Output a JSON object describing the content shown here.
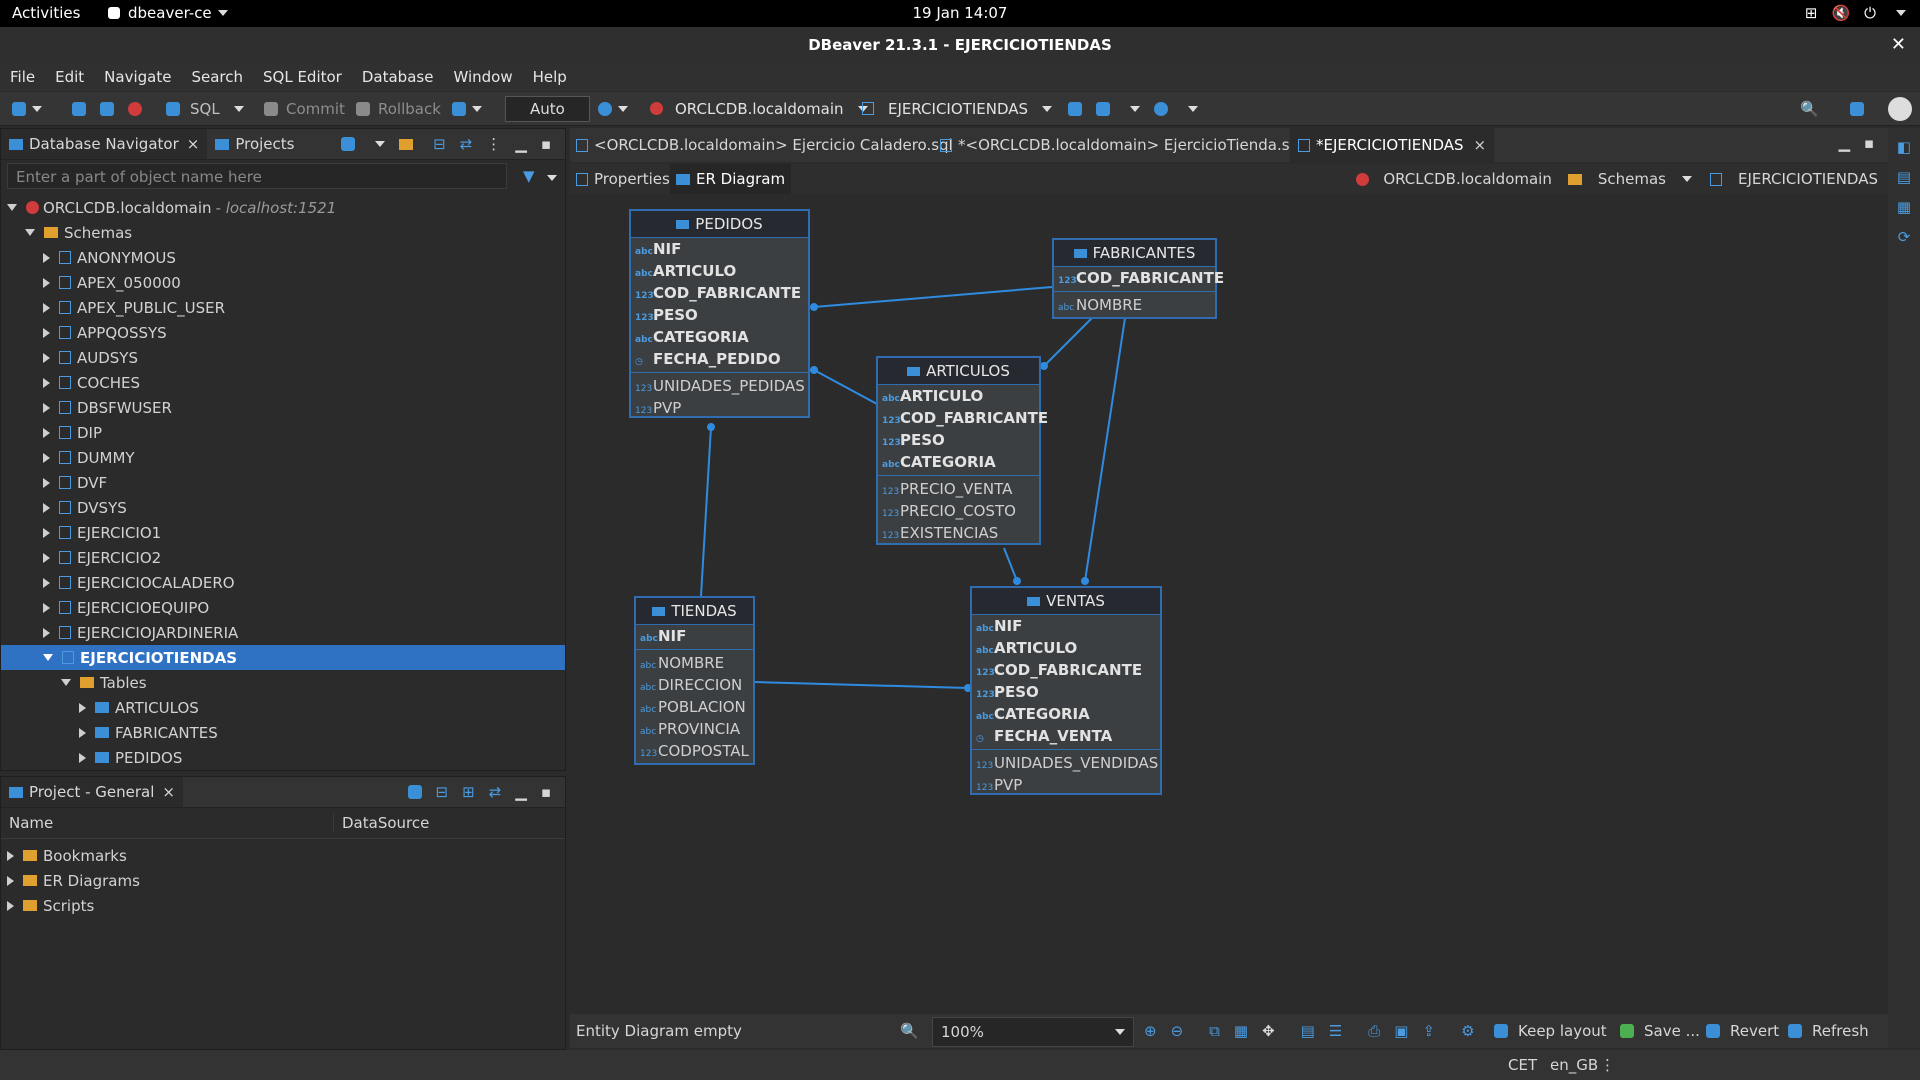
{
  "topbar": {
    "activities": "Activities",
    "app": "dbeaver-ce",
    "clock": "19 Jan  14:07"
  },
  "window": {
    "title": "DBeaver 21.3.1 - EJERCICIOTIENDAS"
  },
  "menu": [
    "File",
    "Edit",
    "Navigate",
    "Search",
    "SQL Editor",
    "Database",
    "Window",
    "Help"
  ],
  "toolbar": {
    "sql": "SQL",
    "commit": "Commit",
    "rollback": "Rollback",
    "mode": "Auto",
    "datasource": "ORCLCDB.localdomain",
    "schema": "EJERCICIOTIENDAS"
  },
  "navigator": {
    "tab_label": "Database Navigator",
    "projects_tab": "Projects",
    "filter_placeholder": "Enter a part of object name here",
    "connection": "ORCLCDB.localdomain",
    "connection_host": " - localhost:1521",
    "schemas_label": "Schemas",
    "schemas": [
      "ANONYMOUS",
      "APEX_050000",
      "APEX_PUBLIC_USER",
      "APPQOSSYS",
      "AUDSYS",
      "COCHES",
      "DBSFWUSER",
      "DIP",
      "DUMMY",
      "DVF",
      "DVSYS",
      "EJERCICIO1",
      "EJERCICIO2",
      "EJERCICIOCALADERO",
      "EJERCICIOEQUIPO",
      "EJERCICIOJARDINERIA"
    ],
    "selected_schema": "EJERCICIOTIENDAS",
    "tables_label": "Tables",
    "tables": [
      "ARTICULOS",
      "FABRICANTES",
      "PEDIDOS"
    ]
  },
  "project": {
    "tab_label": "Project - General",
    "col_name": "Name",
    "col_datasource": "DataSource",
    "items": [
      "Bookmarks",
      "ER Diagrams",
      "Scripts"
    ]
  },
  "editor": {
    "tabs": [
      "<ORCLCDB.localdomain> Ejercicio Caladero.sql",
      "*<ORCLCDB.localdomain> EjercicioTienda.sql",
      "*EJERCICIOTIENDAS"
    ],
    "subtabs": {
      "properties": "Properties",
      "er": "ER Diagram"
    },
    "crumbs": {
      "ds": "ORCLCDB.localdomain",
      "schemas": "Schemas",
      "schema": "EJERCICIOTIENDAS"
    }
  },
  "entities": {
    "pedidos": {
      "name": "PEDIDOS",
      "keys": [
        [
          "abc",
          "NIF"
        ],
        [
          "abc",
          "ARTICULO"
        ],
        [
          "123",
          "COD_FABRICANTE"
        ],
        [
          "123",
          "PESO"
        ],
        [
          "abc",
          "CATEGORIA"
        ],
        [
          "clk",
          "FECHA_PEDIDO"
        ]
      ],
      "cols": [
        [
          "123",
          "UNIDADES_PEDIDAS"
        ],
        [
          "123",
          "PVP"
        ]
      ]
    },
    "fabricantes": {
      "name": "FABRICANTES",
      "keys": [
        [
          "123",
          "COD_FABRICANTE"
        ]
      ],
      "cols": [
        [
          "abc",
          "NOMBRE"
        ]
      ]
    },
    "articulos": {
      "name": "ARTICULOS",
      "keys": [
        [
          "abc",
          "ARTICULO"
        ],
        [
          "123",
          "COD_FABRICANTE"
        ],
        [
          "123",
          "PESO"
        ],
        [
          "abc",
          "CATEGORIA"
        ]
      ],
      "cols": [
        [
          "123",
          "PRECIO_VENTA"
        ],
        [
          "123",
          "PRECIO_COSTO"
        ],
        [
          "123",
          "EXISTENCIAS"
        ]
      ]
    },
    "tiendas": {
      "name": "TIENDAS",
      "keys": [
        [
          "abc",
          "NIF"
        ]
      ],
      "cols": [
        [
          "abc",
          "NOMBRE"
        ],
        [
          "abc",
          "DIRECCION"
        ],
        [
          "abc",
          "POBLACION"
        ],
        [
          "abc",
          "PROVINCIA"
        ],
        [
          "123",
          "CODPOSTAL"
        ]
      ]
    },
    "ventas": {
      "name": "VENTAS",
      "keys": [
        [
          "abc",
          "NIF"
        ],
        [
          "abc",
          "ARTICULO"
        ],
        [
          "123",
          "COD_FABRICANTE"
        ],
        [
          "123",
          "PESO"
        ],
        [
          "abc",
          "CATEGORIA"
        ],
        [
          "clk",
          "FECHA_VENTA"
        ]
      ],
      "cols": [
        [
          "123",
          "UNIDADES_VENDIDAS"
        ],
        [
          "123",
          "PVP"
        ]
      ]
    }
  },
  "erbar": {
    "status": "Entity Diagram  empty",
    "zoom": "100%",
    "keep_layout": "Keep layout",
    "save": "Save ...",
    "revert": "Revert",
    "refresh": "Refresh"
  },
  "statusbar": {
    "tz": "CET",
    "locale": "en_GB"
  }
}
